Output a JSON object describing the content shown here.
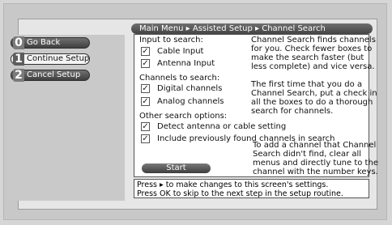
{
  "nav": {
    "items": [
      {
        "num": "0",
        "label": "Go Back"
      },
      {
        "num": "1",
        "label": "Continue Setup"
      },
      {
        "num": "2",
        "label": "Cancel Setup"
      }
    ]
  },
  "breadcrumb": "Main Menu ▸ Assisted Setup ▸ Channel Search",
  "form": {
    "input_heading": "Input to search:",
    "cable_label": "Cable Input",
    "antenna_label": "Antenna Input",
    "channels_heading": "Channels to search:",
    "digital_label": "Digital channels",
    "analog_label": "Analog channels",
    "other_heading": "Other search options:",
    "detect_label": "Detect antenna or cable setting",
    "include_label": "Include previously found channels in search",
    "start_label": "Start",
    "check_mark": "✓"
  },
  "help": {
    "lines_1": [
      "Channel Search finds channels",
      "for you. Check fewer boxes to",
      "make the search faster (but",
      "less complete) and vice versa."
    ],
    "lines_2": [
      "The first time that you do a",
      "Channel Search, put a check in",
      "all the boxes to do a thorough",
      "search for channels."
    ],
    "lines_3": [
      "To add a channel that Channel",
      "Search didn't find, clear all",
      "menus and directly tune to the",
      "channel with the number keys."
    ]
  },
  "status": {
    "line_1": "Press ▸ to make changes to this screen's settings.",
    "line_2": "Press OK to skip to the next step in the setup routine."
  }
}
